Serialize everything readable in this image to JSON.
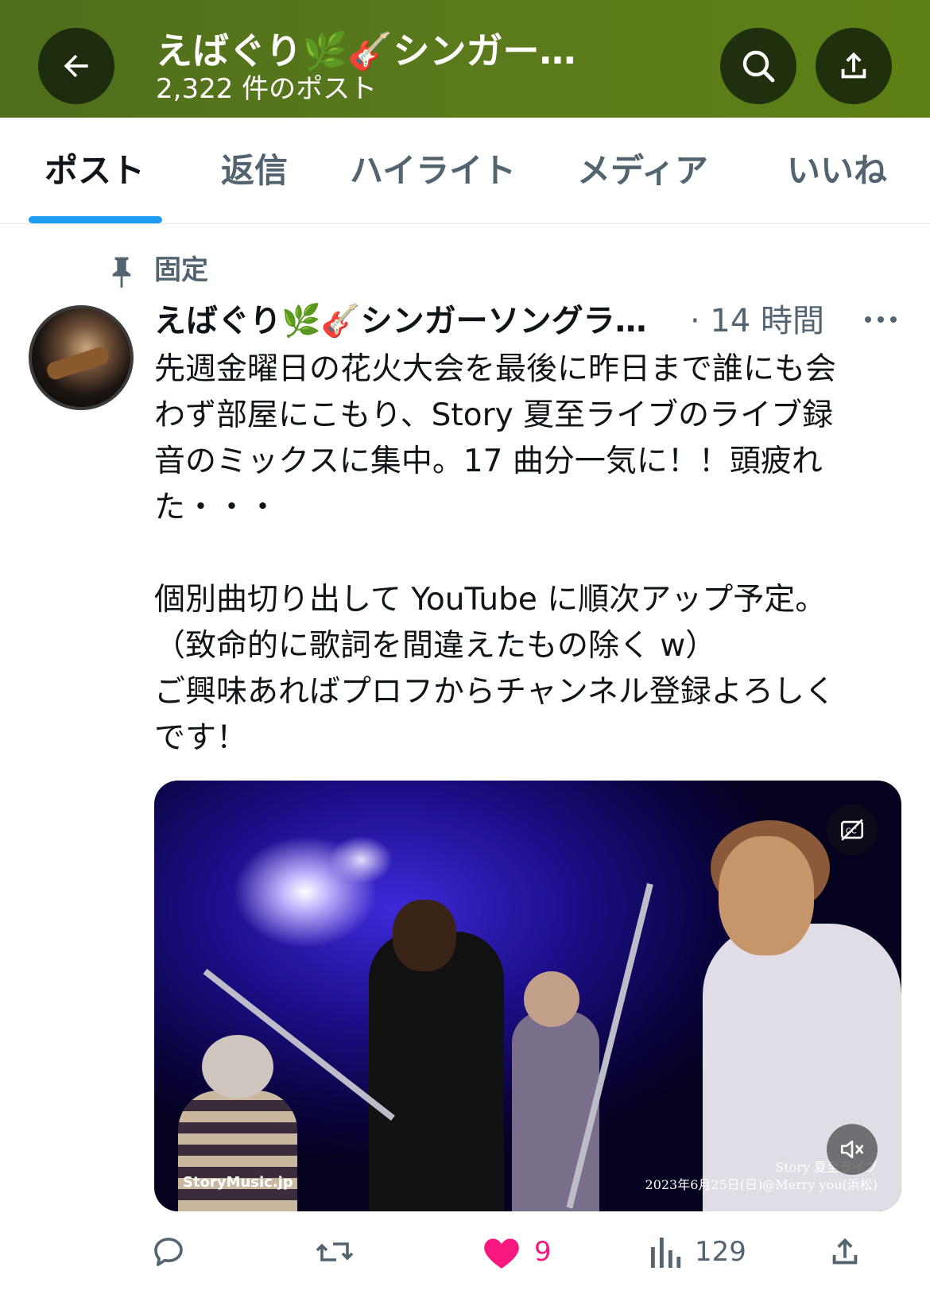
{
  "header": {
    "title": "えばぐり🌿🎸シンガー…",
    "post_count": "2,322 件のポスト"
  },
  "tabs": [
    {
      "label": "ポスト",
      "active": true
    },
    {
      "label": "返信",
      "active": false
    },
    {
      "label": "ハイライト",
      "active": false
    },
    {
      "label": "メディア",
      "active": false
    },
    {
      "label": "いいね",
      "active": false
    }
  ],
  "post": {
    "pinned_label": "固定",
    "author": "えばぐり🌿🎸シンガーソングラ…",
    "time": "· 14 時間",
    "text": "先週金曜日の花火大会を最後に昨日まで誰にも会\nわず部屋にこもり、Story 夏至ライブのライブ録\n音のミックスに集中。17 曲分一気に！！頭疲れ\nた・・・\n\n個別曲切り出して YouTube に順次アップ予定。\n（致命的に歌詞を間違えたもの除く w）\nご興味あればプロフからチャンネル登録よろしく\nです！",
    "media": {
      "watermark_left": "StoryMusic.jp",
      "watermark_right_line1": "Story 夏至ライブ",
      "watermark_right_line2": "2023年6月25日(日)@Merry you(浜松)"
    },
    "actions": {
      "replies": "",
      "reposts": "",
      "likes": "9",
      "views": "129"
    }
  },
  "colors": {
    "header_bg": "#5a7a1c",
    "accent": "#1d9bf0",
    "like": "#f91880",
    "secondary_text": "#536471"
  }
}
